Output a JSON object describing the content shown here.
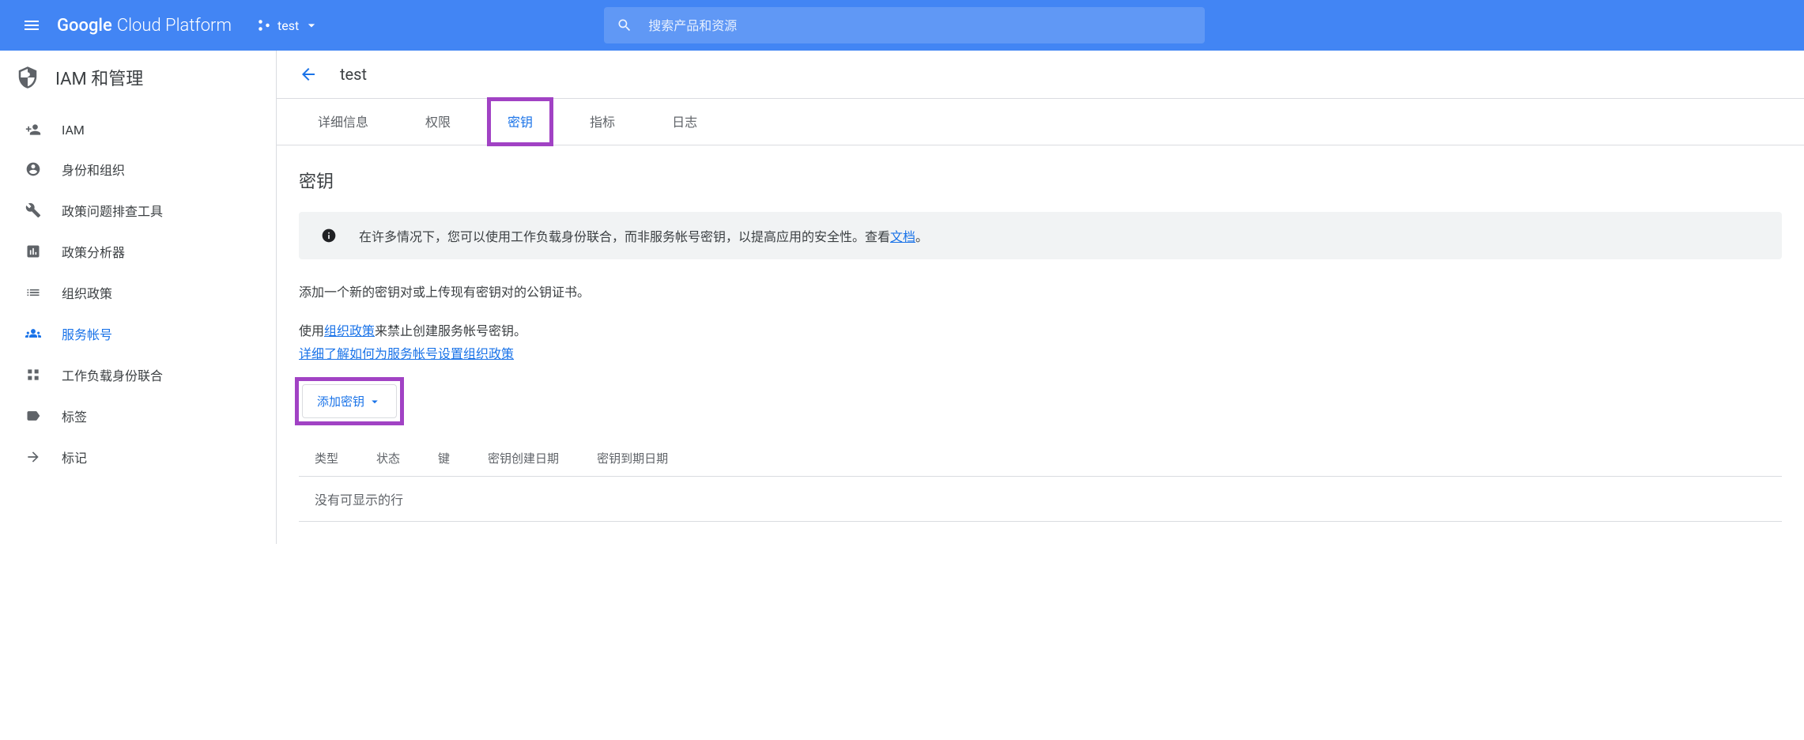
{
  "topbar": {
    "logo_google": "Google",
    "logo_rest": "Cloud Platform",
    "project": "test",
    "search_placeholder": "搜索产品和资源"
  },
  "sidebar": {
    "title": "IAM 和管理",
    "items": [
      {
        "label": "IAM"
      },
      {
        "label": "身份和组织"
      },
      {
        "label": "政策问题排查工具"
      },
      {
        "label": "政策分析器"
      },
      {
        "label": "组织政策"
      },
      {
        "label": "服务帐号"
      },
      {
        "label": "工作负载身份联合"
      },
      {
        "label": "标签"
      },
      {
        "label": "标记"
      }
    ]
  },
  "main": {
    "title": "test",
    "tabs": [
      {
        "label": "详细信息"
      },
      {
        "label": "权限"
      },
      {
        "label": "密钥"
      },
      {
        "label": "指标"
      },
      {
        "label": "日志"
      }
    ],
    "section_title": "密钥",
    "info_text_1": "在许多情况下，您可以使用工作负载身份联合，而非服务帐号密钥，以提高应用的安全性。查看",
    "info_link": "文档",
    "info_text_2": "。",
    "desc_1": "添加一个新的密钥对或上传现有密钥对的公钥证书。",
    "desc_2a": "使用",
    "desc_2_link": "组织政策",
    "desc_2b": "来禁止创建服务帐号密钥。",
    "desc_3_link": "详细了解如何为服务帐号设置组织政策",
    "add_key_label": "添加密钥",
    "table_headers": [
      "类型",
      "状态",
      "键",
      "密钥创建日期",
      "密钥到期日期"
    ],
    "table_empty": "没有可显示的行"
  }
}
